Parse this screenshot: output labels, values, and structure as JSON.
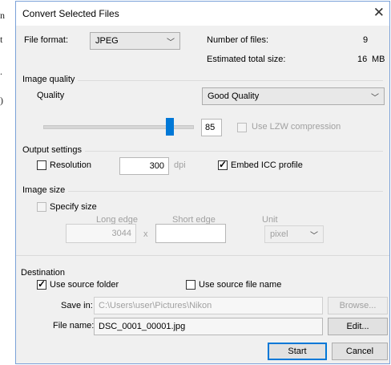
{
  "background": {
    "lines": [
      "n",
      "t",
      ".",
      ")"
    ]
  },
  "dialog": {
    "title": "Convert Selected Files",
    "close_glyph": "✕"
  },
  "file_format": {
    "label": "File format:",
    "value": "JPEG"
  },
  "summary": {
    "number_label": "Number of files:",
    "number_value": "9",
    "size_label": "Estimated total size:",
    "size_value": "16",
    "size_unit": "MB"
  },
  "image_quality": {
    "group": "Image quality",
    "quality_label": "Quality",
    "quality_value": "Good Quality",
    "slider_value": "85",
    "slider_fraction": 0.85,
    "lzw_label": "Use LZW compression"
  },
  "output": {
    "group": "Output settings",
    "resolution_label": "Resolution",
    "resolution_value": "300",
    "resolution_unit": "dpi",
    "icc_label": "Embed ICC profile"
  },
  "image_size": {
    "group": "Image size",
    "specify_label": "Specify size",
    "long_label": "Long edge",
    "long_value": "3044",
    "times": "x",
    "short_label": "Short edge",
    "short_value": "",
    "unit_label": "Unit",
    "unit_value": "pixel"
  },
  "destination": {
    "group": "Destination",
    "use_source_folder": "Use source folder",
    "use_source_name": "Use source file name",
    "save_in_label": "Save in:",
    "save_in_value": "C:\\Users\\user\\Pictures\\Nikon",
    "browse": "Browse...",
    "filename_label": "File name:",
    "filename_value": "DSC_0001_00001.jpg",
    "edit": "Edit..."
  },
  "actions": {
    "start": "Start",
    "cancel": "Cancel"
  },
  "colors": {
    "accent": "#0078d7",
    "border": "#7aa1d8"
  }
}
